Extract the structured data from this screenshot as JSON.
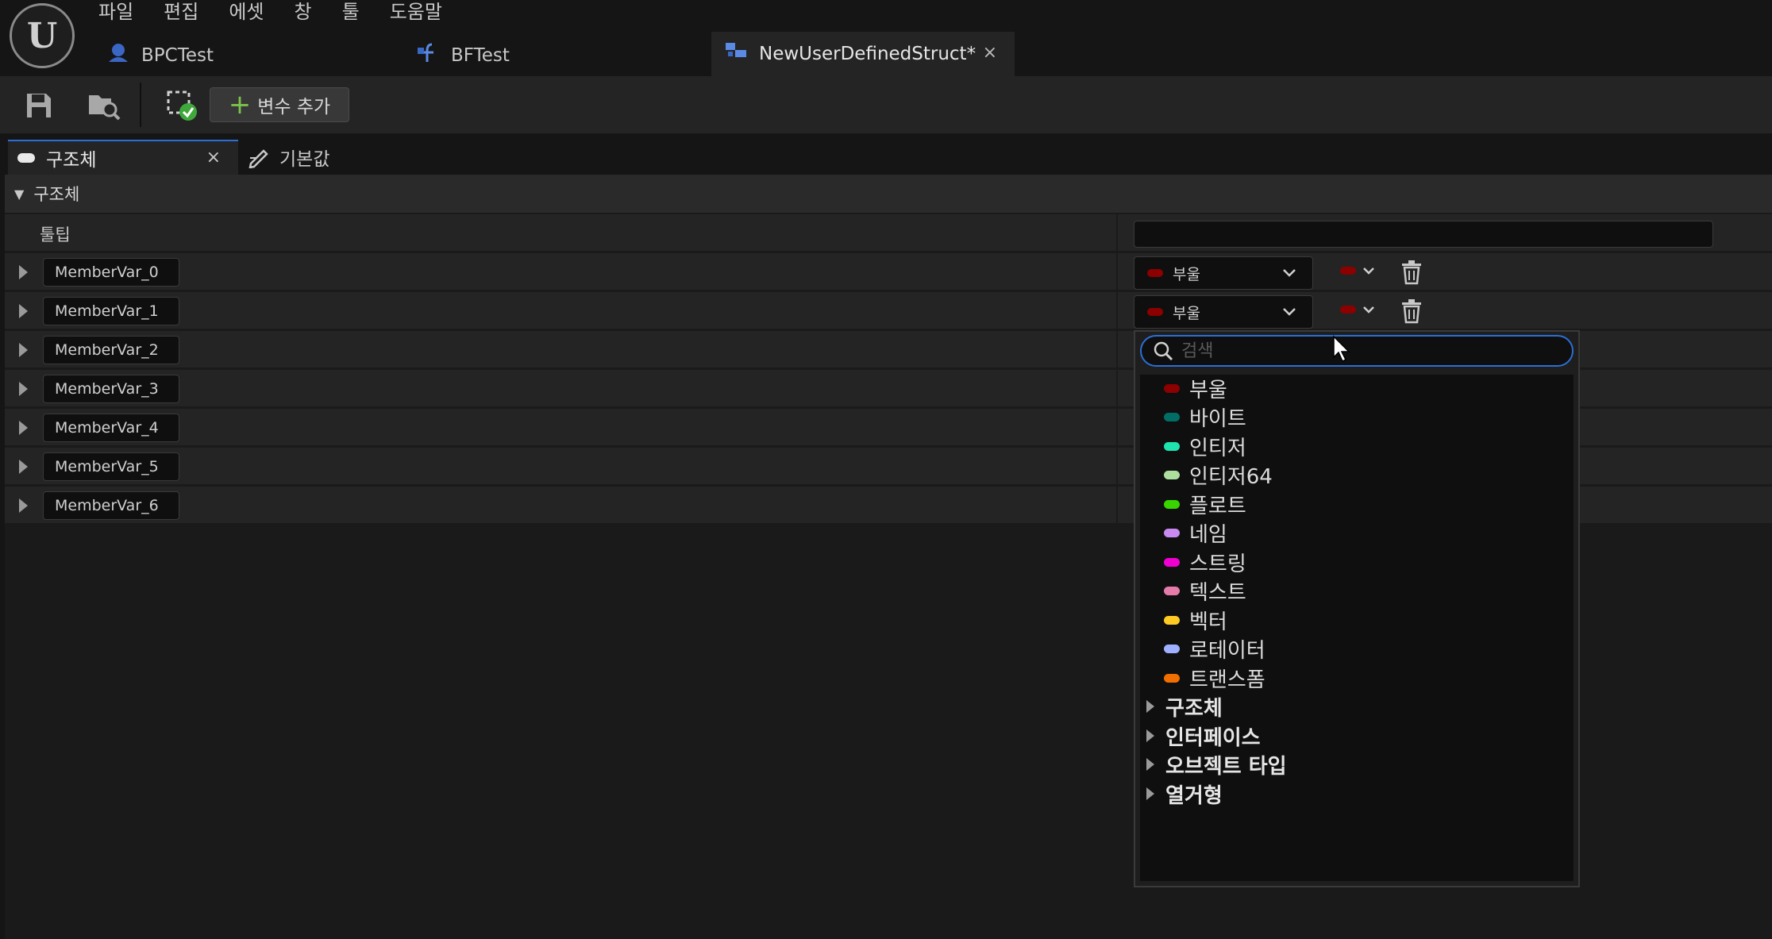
{
  "menu": [
    "파일",
    "편집",
    "에셋",
    "창",
    "툴",
    "도움말"
  ],
  "doc_tabs": [
    {
      "label": "BPCTest"
    },
    {
      "label": "BFTest"
    },
    {
      "label": "NewUserDefinedStruct*",
      "close": "×"
    }
  ],
  "toolbar": {
    "add_variable_label": "변수 추가"
  },
  "panel_tabs": [
    {
      "label": "구조체",
      "close": "×"
    },
    {
      "label": "기본값"
    }
  ],
  "section": {
    "title": "구조체"
  },
  "tooltip_row": {
    "label": "툴팁",
    "value": ""
  },
  "members": [
    {
      "name": "MemberVar_0",
      "type": "부울"
    },
    {
      "name": "MemberVar_1",
      "type": "부울"
    },
    {
      "name": "MemberVar_2"
    },
    {
      "name": "MemberVar_3"
    },
    {
      "name": "MemberVar_4"
    },
    {
      "name": "MemberVar_5"
    },
    {
      "name": "MemberVar_6"
    }
  ],
  "dropdown": {
    "search_placeholder": "검색",
    "types": [
      {
        "label": "부울",
        "color": "#8c0000"
      },
      {
        "label": "바이트",
        "color": "#006e65"
      },
      {
        "label": "인티저",
        "color": "#1fe3af"
      },
      {
        "label": "인티저64",
        "color": "#acdf9f"
      },
      {
        "label": "플로트",
        "color": "#38d500"
      },
      {
        "label": "네임",
        "color": "#c88af0"
      },
      {
        "label": "스트링",
        "color": "#f000d0"
      },
      {
        "label": "텍스트",
        "color": "#e57ba8"
      },
      {
        "label": "벡터",
        "color": "#ffca23"
      },
      {
        "label": "로테이터",
        "color": "#9eb0ff"
      },
      {
        "label": "트랜스폼",
        "color": "#f06f00"
      }
    ],
    "categories": [
      "구조체",
      "인터페이스",
      "오브젝트 타입",
      "열거형"
    ]
  }
}
